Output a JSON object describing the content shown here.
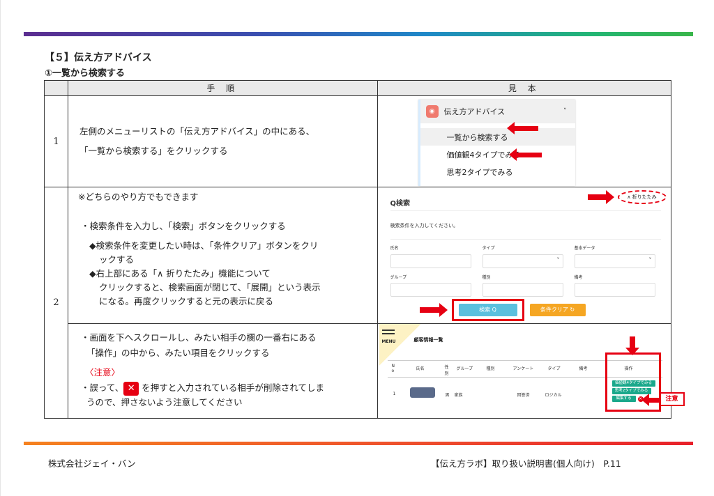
{
  "header": {
    "section": "【５】伝え方アドバイス",
    "subsection": "①一覧から検索する"
  },
  "table": {
    "col_step": "手 順",
    "col_sample": "見 本",
    "rows": [
      {
        "num": "1",
        "lines": [
          "左側のメニューリストの「伝え方アドバイス」の中にある、",
          "「一覧から検索する」をクリックする"
        ]
      },
      {
        "num": "2",
        "part_a": {
          "lead": "※どちらのやり方でもできます",
          "b1": "・検索条件を入力し、「検索」ボタンをクリックする",
          "b2a": "◆検索条件を変更したい時は、「条件クリア」ボタンをクリ",
          "b2b": "ックする",
          "b3a": "◆右上部にある「∧ 折りたたみ」機能について",
          "b3b": "クリックすると、検索画面が閉じて、「展開」という表示",
          "b3c": "になる。再度クリックすると元の表示に戻る"
        },
        "part_b": {
          "b1a": "・画面を下へスクロールし、みたい相手の欄の一番右にある",
          "b1b": "「操作」の中から、みたい項目をクリックする",
          "caution": "〈注意〉",
          "c1_pre": "・誤って、",
          "c1_x": "✕",
          "c1_post": "を押すと入力されている相手が削除されてしま",
          "c2": "うので、押さないよう注意してください"
        }
      }
    ]
  },
  "sample1": {
    "menu_title": "伝え方アドバイス",
    "items": [
      "一覧から検索する",
      "価値観4タイプでみる",
      "思考2タイプでみる"
    ]
  },
  "sample2": {
    "title": "Q検索",
    "fold": "∧ 折りたたみ",
    "hint": "検索条件を入力してください。",
    "labels": [
      "氏名",
      "タイプ",
      "基本データ",
      "グループ",
      "種別",
      "備考"
    ],
    "search_btn": "検索 Q",
    "clear_btn": "条件クリア ↻"
  },
  "sample3": {
    "menu": "MENU",
    "heading": "顧客情報一覧",
    "cols": [
      "N o",
      "氏名",
      "性別",
      "グループ",
      "種別",
      "アンケート",
      "タイプ",
      "備考",
      "操作"
    ],
    "row": {
      "no": "1",
      "sex": "男",
      "group": "家族",
      "anq": "回答済",
      "type": "ロジカル"
    },
    "ops": [
      "価値観4タイプでみる",
      "思考2タイプでみる",
      "編集する"
    ],
    "note": "注意"
  },
  "footer": {
    "company": "株式会社ジェイ・バン",
    "doc": "【伝え方ラボ】取り扱い説明書(個人向け)　P.11"
  }
}
